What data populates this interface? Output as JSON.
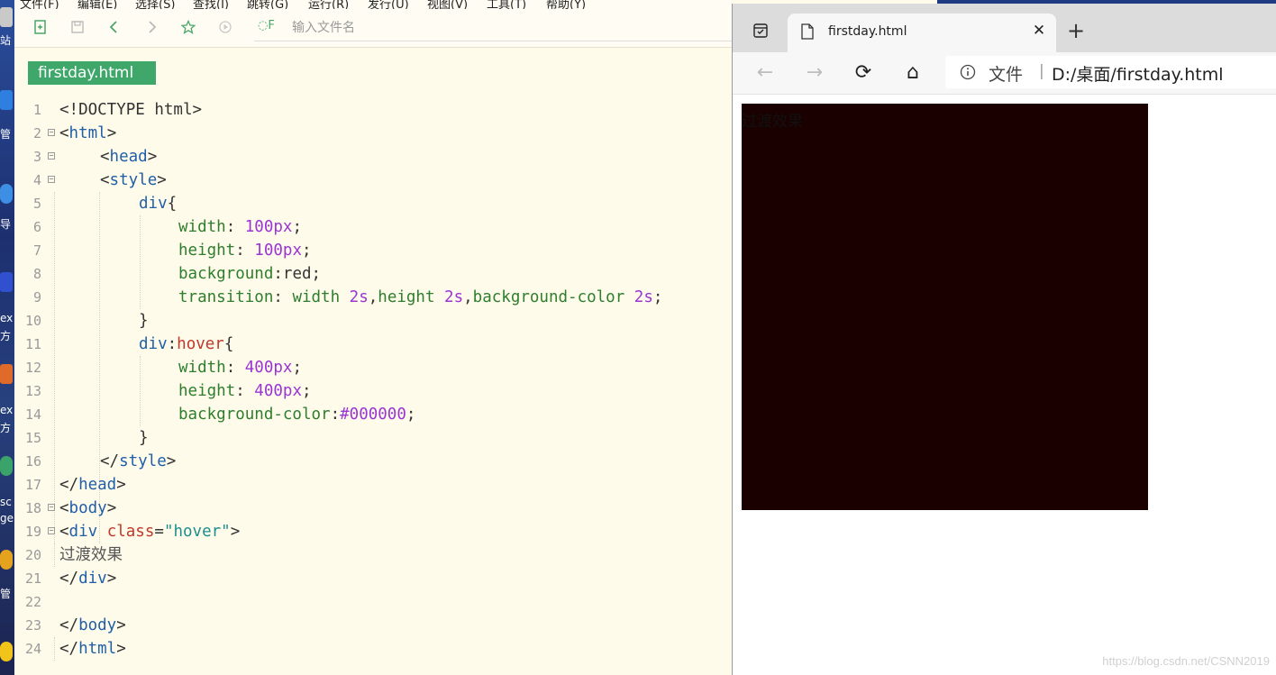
{
  "desktop": {
    "labels": [
      "站",
      "管",
      "导",
      "ex",
      "方",
      "ex",
      "方",
      "sc",
      "ge",
      "管"
    ]
  },
  "editor": {
    "menu": [
      "文件(F)",
      "编辑(E)",
      "选择(S)",
      "查找(I)",
      "跳转(G)",
      "运行(R)",
      "发行(U)",
      "视图(V)",
      "工具(T)",
      "帮助(Y)"
    ],
    "search_placeholder": "输入文件名",
    "search_icon_text": "◌F",
    "tab_title": "firstday.html",
    "line_numbers": [
      "1",
      "2",
      "3",
      "4",
      "5",
      "6",
      "7",
      "8",
      "9",
      "10",
      "11",
      "12",
      "13",
      "14",
      "15",
      "16",
      "17",
      "18",
      "19",
      "20",
      "21",
      "22",
      "23",
      "24"
    ],
    "code": {
      "l1": "<!DOCTYPE html>",
      "l2_open": "<",
      "l2_tag": "html",
      "l2_close": ">",
      "l3_open": "<",
      "l3_tag": "head",
      "l3_close": ">",
      "l4_open": "<",
      "l4_tag": "style",
      "l4_close": ">",
      "l5_sel": "div",
      "l5_brace": "{",
      "l6_prop": "width",
      "l6_colon": ": ",
      "l6_val": "100px",
      "l6_semi": ";",
      "l7_prop": "height",
      "l7_colon": ": ",
      "l7_val": "100px",
      "l7_semi": ";",
      "l8_prop": "background",
      "l8_colon": ":",
      "l8_val": "red",
      "l8_semi": ";",
      "l9_prop": "transition",
      "l9_colon": ": ",
      "l9_a": "width ",
      "l9_a_num": "2s",
      "l9_c1": ",",
      "l9_b": "height ",
      "l9_b_num": "2s",
      "l9_c2": ",",
      "l9_c": "background-color ",
      "l9_c_num": "2s",
      "l9_semi": ";",
      "l10": "}",
      "l11_sel": "div",
      "l11_colon": ":",
      "l11_pseudo": "hover",
      "l11_brace": "{",
      "l12_prop": "width",
      "l12_colon": ": ",
      "l12_val": "400px",
      "l12_semi": ";",
      "l13_prop": "height",
      "l13_colon": ": ",
      "l13_val": "400px",
      "l13_semi": ";",
      "l14_prop": "background-color",
      "l14_colon": ":",
      "l14_val": "#000000",
      "l14_semi": ";",
      "l15": "}",
      "l16_open": "</",
      "l16_tag": "style",
      "l16_close": ">",
      "l17_open": "</",
      "l17_tag": "head",
      "l17_close": ">",
      "l18_open": "<",
      "l18_tag": "body",
      "l18_close": ">",
      "l19_open": "<",
      "l19_tag": "div",
      "l19_attr": "class",
      "l19_eq": "=",
      "l19_str": "\"hover\"",
      "l19_close": ">",
      "l20": "过渡效果",
      "l21_open": "</",
      "l21_tag": "div",
      "l21_close": ">",
      "l23_open": "</",
      "l23_tag": "body",
      "l23_close": ">",
      "l24_open": "</",
      "l24_tag": "html",
      "l24_close": ">"
    }
  },
  "browser": {
    "tab_title": "firstday.html",
    "close_glyph": "✕",
    "new_tab_glyph": "+",
    "back_glyph": "←",
    "forward_glyph": "→",
    "reload_glyph": "⟳",
    "home_glyph": "⌂",
    "address_label": "文件",
    "address_sep": "|",
    "url": "D:/桌面/firstday.html",
    "page_text": "过渡效果",
    "box_color": "#1b0000",
    "watermark": "https://blog.csdn.net/CSNN2019"
  },
  "colors": {
    "editor_bg": "#fffbea",
    "tab_green": "#3fa76a",
    "tag_blue": "#1f5fa8",
    "prop_green": "#2d7e2d",
    "number_purple": "#9a35d3",
    "pseudo_red": "#c0392b"
  },
  "icons": {
    "toolbar": [
      "new-file-icon",
      "save-icon",
      "back-icon",
      "forward-icon",
      "star-icon",
      "run-icon",
      "file-search-icon"
    ],
    "browser": [
      "tab-actions-icon",
      "page-icon",
      "close-icon",
      "plus-icon",
      "back-icon",
      "forward-icon",
      "reload-icon",
      "home-icon",
      "info-icon"
    ]
  }
}
